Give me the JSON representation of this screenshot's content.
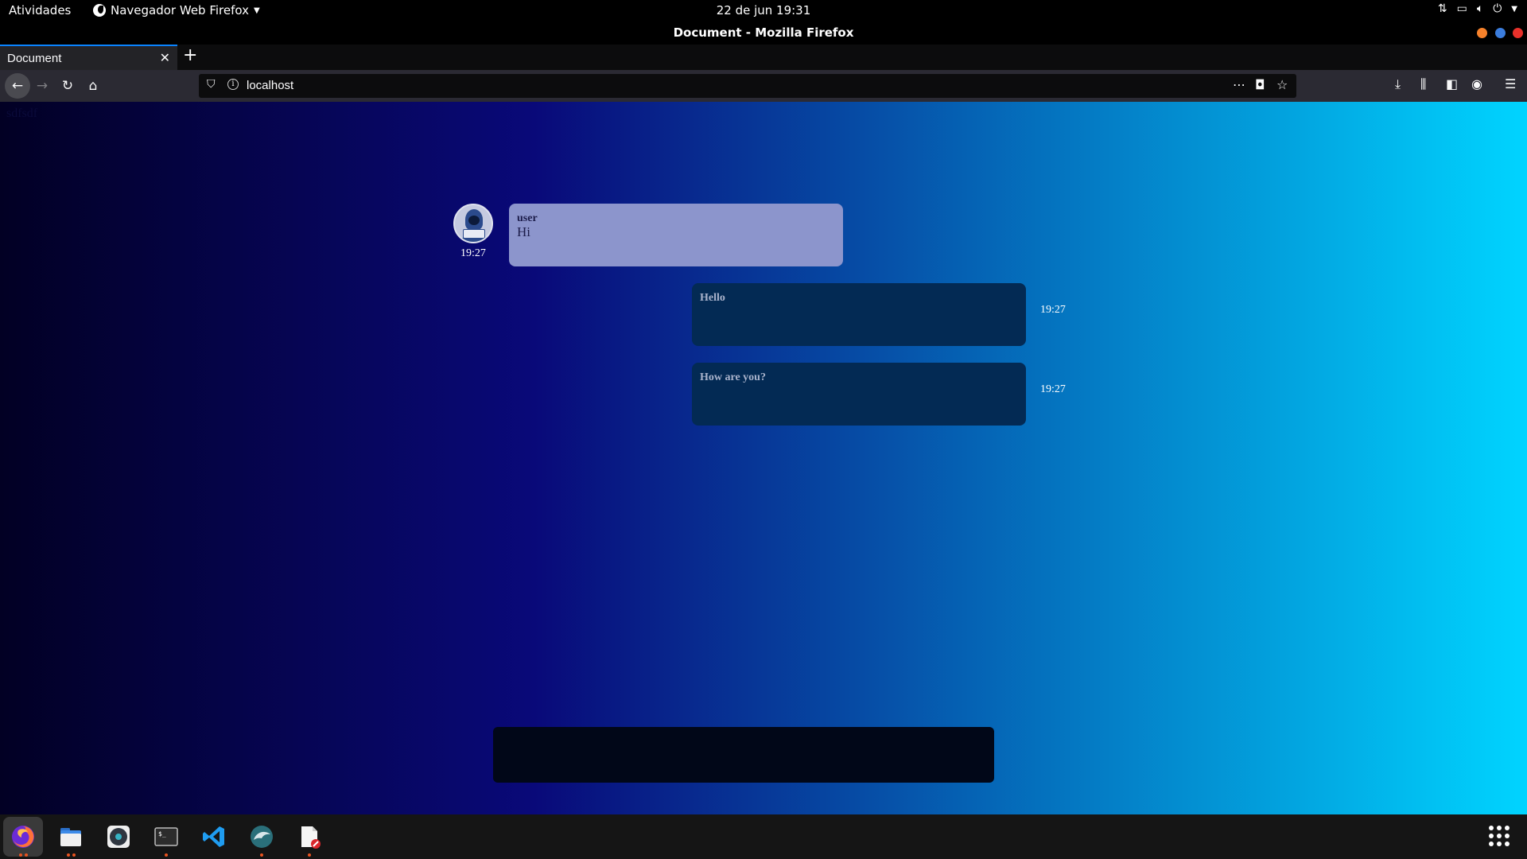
{
  "topbar": {
    "activities": "Atividades",
    "app_menu": "Navegador Web Firefox",
    "clock": "22 de jun  19:31",
    "tray_icons": [
      "network-icon",
      "screen-icon",
      "volume-icon",
      "power-icon",
      "chevron-down-icon"
    ]
  },
  "window": {
    "title": "Document - Mozilla Firefox",
    "buttons": {
      "minimize": "#f7822b",
      "maximize": "#3b7ddd",
      "close": "#e8312b"
    }
  },
  "tabs": [
    {
      "label": "Document",
      "active": true
    }
  ],
  "navbar": {
    "url": "localhost"
  },
  "page": {
    "background": [
      "#020024",
      "#090979",
      "#00d4ff"
    ],
    "ghost_text": "sdfsdf",
    "messages": [
      {
        "direction": "incoming",
        "sender": "user",
        "text": "Hi",
        "time": "19:27"
      },
      {
        "direction": "outgoing",
        "text": "Hello",
        "time": "19:27"
      },
      {
        "direction": "outgoing",
        "text": "How are you?",
        "time": "19:27"
      }
    ],
    "composer": {
      "value": "",
      "placeholder": ""
    }
  },
  "dock": {
    "items": [
      {
        "name": "firefox",
        "running": true
      },
      {
        "name": "files",
        "running": true
      },
      {
        "name": "rhythmbox",
        "running": false
      },
      {
        "name": "terminal",
        "running": true
      },
      {
        "name": "vscode",
        "running": false
      },
      {
        "name": "mysql-workbench",
        "running": true
      },
      {
        "name": "text-editor",
        "running": true
      }
    ]
  }
}
